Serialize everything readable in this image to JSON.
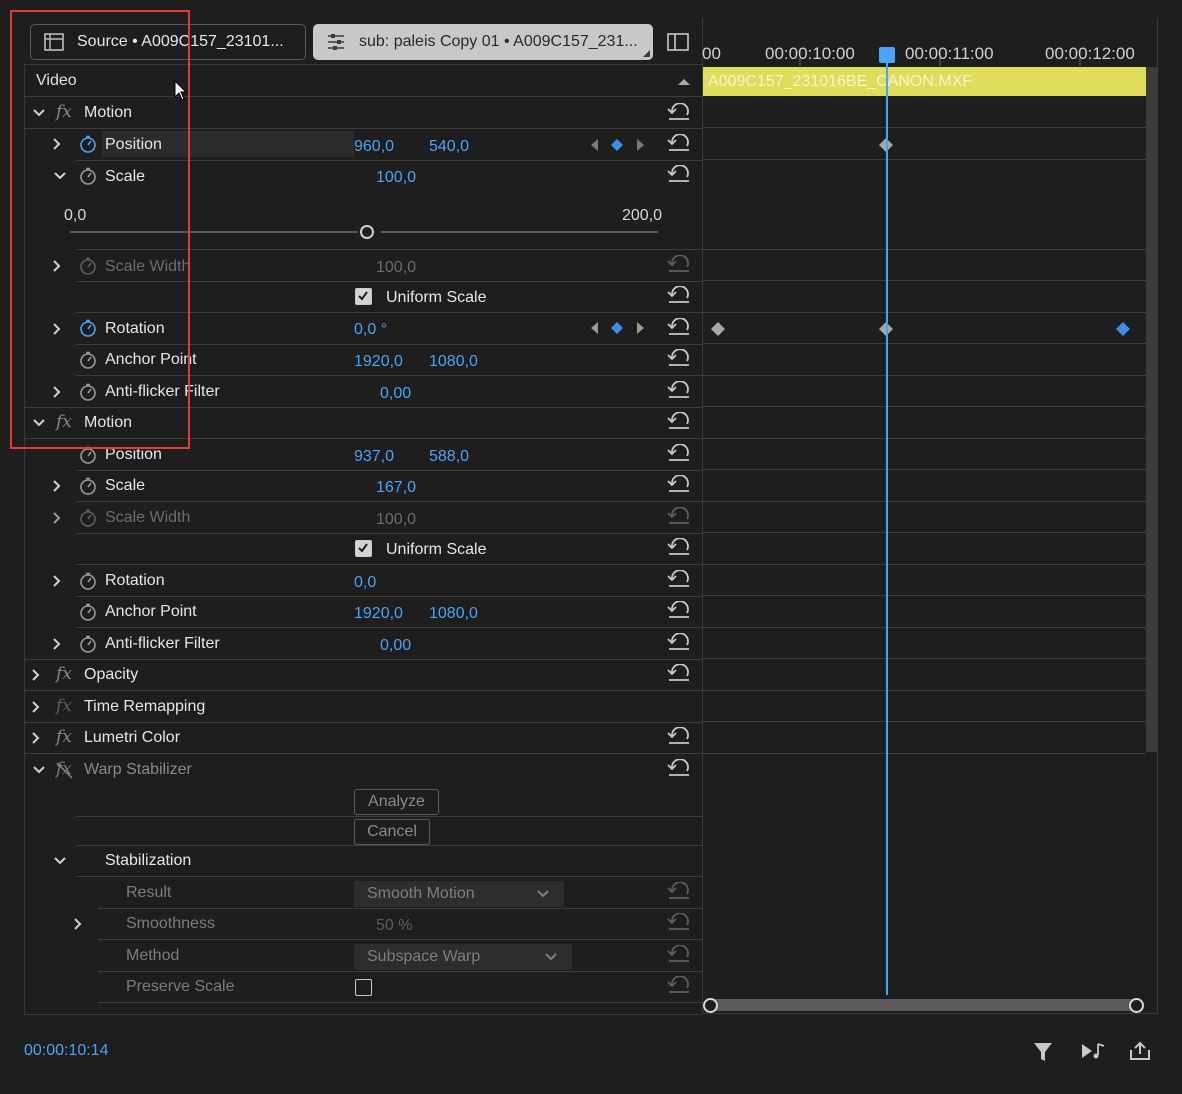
{
  "tabs": {
    "source": "Source • A009C157_23101...",
    "effect_controls": "sub: paleis Copy 01 • A009C157_231..."
  },
  "video_header": "Video",
  "motion1": {
    "title": "Motion",
    "position": {
      "label": "Position",
      "x": "960,0",
      "y": "540,0"
    },
    "scale": {
      "label": "Scale",
      "value": "100,0",
      "slider_min": "0,0",
      "slider_max": "200,0"
    },
    "scale_width": {
      "label": "Scale Width",
      "value": "100,0"
    },
    "uniform_scale": "Uniform Scale",
    "rotation": {
      "label": "Rotation",
      "value": "0,0 °"
    },
    "anchor_point": {
      "label": "Anchor Point",
      "x": "1920,0",
      "y": "1080,0"
    },
    "anti_flicker": {
      "label": "Anti-flicker Filter",
      "value": "0,00"
    }
  },
  "motion2": {
    "title": "Motion",
    "position": {
      "label": "Position",
      "x": "937,0",
      "y": "588,0"
    },
    "scale": {
      "label": "Scale",
      "value": "167,0"
    },
    "scale_width": {
      "label": "Scale Width",
      "value": "100,0"
    },
    "uniform_scale": "Uniform Scale",
    "rotation": {
      "label": "Rotation",
      "value": "0,0"
    },
    "anchor_point": {
      "label": "Anchor Point",
      "x": "1920,0",
      "y": "1080,0"
    },
    "anti_flicker": {
      "label": "Anti-flicker Filter",
      "value": "0,00"
    }
  },
  "effects": {
    "opacity": "Opacity",
    "time_remapping": "Time Remapping",
    "lumetri": "Lumetri Color",
    "warp": "Warp Stabilizer"
  },
  "warp": {
    "analyze": "Analyze",
    "cancel": "Cancel",
    "stabilization": "Stabilization",
    "result_label": "Result",
    "result_value": "Smooth Motion",
    "smoothness_label": "Smoothness",
    "smoothness_value": "50 %",
    "method_label": "Method",
    "method_value": "Subspace Warp",
    "preserve_scale_label": "Preserve Scale"
  },
  "timeline": {
    "ruler": [
      "00",
      "00:00:10:00",
      "00:00:11:00",
      "00:00:12:00"
    ],
    "clip_name": "A009C157_231016BE_CANON.MXF"
  },
  "current_time": "00:00:10:14",
  "colors": {
    "accent": "#4aa3f5",
    "clip": "#dede5a",
    "highlight_box": "#e03c3c"
  }
}
